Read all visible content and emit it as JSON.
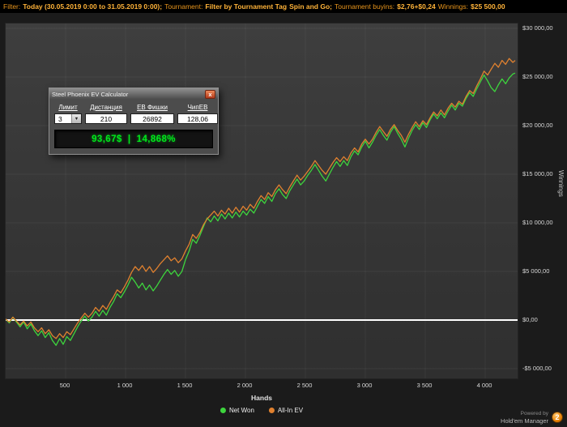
{
  "topbar": {
    "filter_label": "Filter:",
    "filter_value": "Today (30.05.2019 0:00 to 31.05.2019 0:00);",
    "tournament_label": "Tournament:",
    "tournament_value": "Filter by Tournament Tag",
    "tag_value": "Spin and Go;",
    "buyins_label": "Tournament buyins:",
    "buyins_value": "$2,76+$0,24",
    "winnings_label": "Winnings:",
    "winnings_value": "$25 500,00"
  },
  "ev_calculator": {
    "title": "Steel Phoenix EV Calculator",
    "close_glyph": "x",
    "columns": [
      "Лимит",
      "Дистанция",
      "ЕВ Фишки",
      "ЧипЕВ"
    ],
    "limit_value": "3",
    "dropdown_arrow": "▼",
    "distance_value": "210",
    "ev_chips_value": "26892",
    "chip_ev_value": "128,06",
    "result": "93,67$  |  14,868%"
  },
  "chart_data": {
    "type": "line",
    "title": "",
    "xlabel": "Hands",
    "ylabel": "Winnings",
    "xlim": [
      0,
      4270
    ],
    "ylim": [
      -6000,
      30500
    ],
    "grid": true,
    "legend_position": "bottom",
    "zero_line_color": "#ffffff",
    "x_ticks": [
      {
        "v": 500,
        "label": "500"
      },
      {
        "v": 1000,
        "label": "1 000"
      },
      {
        "v": 1500,
        "label": "1 500"
      },
      {
        "v": 2000,
        "label": "2 000"
      },
      {
        "v": 2500,
        "label": "2 500"
      },
      {
        "v": 3000,
        "label": "3 000"
      },
      {
        "v": 3500,
        "label": "3 500"
      },
      {
        "v": 4000,
        "label": "4 000"
      }
    ],
    "y_ticks": [
      {
        "v": 30000,
        "label": "$30 000,00"
      },
      {
        "v": 25000,
        "label": "$25 000,00"
      },
      {
        "v": 20000,
        "label": "$20 000,00"
      },
      {
        "v": 15000,
        "label": "$15 000,00"
      },
      {
        "v": 10000,
        "label": "$10 000,00"
      },
      {
        "v": 5000,
        "label": "$5 000,00"
      },
      {
        "v": 0,
        "label": "$0,00"
      },
      {
        "v": -5000,
        "label": "-$5 000,00"
      }
    ],
    "series": [
      {
        "name": "Net Won",
        "color": "#3dd43d",
        "points": [
          [
            0,
            100
          ],
          [
            30,
            -300
          ],
          [
            60,
            300
          ],
          [
            90,
            -200
          ],
          [
            120,
            -700
          ],
          [
            150,
            -200
          ],
          [
            180,
            -900
          ],
          [
            210,
            -400
          ],
          [
            240,
            -1100
          ],
          [
            270,
            -1600
          ],
          [
            300,
            -1100
          ],
          [
            330,
            -1800
          ],
          [
            360,
            -1300
          ],
          [
            390,
            -2100
          ],
          [
            420,
            -2600
          ],
          [
            450,
            -1900
          ],
          [
            480,
            -2500
          ],
          [
            510,
            -1700
          ],
          [
            540,
            -2100
          ],
          [
            570,
            -1400
          ],
          [
            600,
            -700
          ],
          [
            630,
            -100
          ],
          [
            660,
            400
          ],
          [
            690,
            -100
          ],
          [
            720,
            300
          ],
          [
            750,
            900
          ],
          [
            780,
            400
          ],
          [
            810,
            1000
          ],
          [
            840,
            500
          ],
          [
            870,
            1300
          ],
          [
            900,
            1900
          ],
          [
            930,
            2700
          ],
          [
            960,
            2300
          ],
          [
            990,
            2900
          ],
          [
            1020,
            3600
          ],
          [
            1050,
            4400
          ],
          [
            1080,
            3900
          ],
          [
            1110,
            3300
          ],
          [
            1140,
            3800
          ],
          [
            1170,
            3100
          ],
          [
            1200,
            3600
          ],
          [
            1230,
            3000
          ],
          [
            1260,
            3500
          ],
          [
            1290,
            4100
          ],
          [
            1320,
            4700
          ],
          [
            1350,
            5200
          ],
          [
            1380,
            4700
          ],
          [
            1410,
            5100
          ],
          [
            1440,
            4500
          ],
          [
            1470,
            5000
          ],
          [
            1500,
            6200
          ],
          [
            1530,
            7100
          ],
          [
            1560,
            8300
          ],
          [
            1590,
            7900
          ],
          [
            1620,
            8700
          ],
          [
            1650,
            9600
          ],
          [
            1680,
            10500
          ],
          [
            1710,
            10100
          ],
          [
            1740,
            10700
          ],
          [
            1770,
            10200
          ],
          [
            1800,
            10900
          ],
          [
            1830,
            10400
          ],
          [
            1860,
            11000
          ],
          [
            1890,
            10500
          ],
          [
            1920,
            11100
          ],
          [
            1950,
            10600
          ],
          [
            1980,
            11200
          ],
          [
            2010,
            10800
          ],
          [
            2040,
            11400
          ],
          [
            2070,
            11000
          ],
          [
            2100,
            11700
          ],
          [
            2130,
            12400
          ],
          [
            2160,
            12000
          ],
          [
            2190,
            12700
          ],
          [
            2220,
            12200
          ],
          [
            2250,
            13000
          ],
          [
            2280,
            13500
          ],
          [
            2310,
            12900
          ],
          [
            2340,
            12500
          ],
          [
            2370,
            13300
          ],
          [
            2400,
            13900
          ],
          [
            2430,
            14500
          ],
          [
            2460,
            13900
          ],
          [
            2490,
            14300
          ],
          [
            2520,
            14900
          ],
          [
            2550,
            15400
          ],
          [
            2580,
            16000
          ],
          [
            2610,
            15400
          ],
          [
            2640,
            14800
          ],
          [
            2670,
            14300
          ],
          [
            2700,
            15000
          ],
          [
            2730,
            15700
          ],
          [
            2760,
            16300
          ],
          [
            2790,
            15800
          ],
          [
            2820,
            16400
          ],
          [
            2850,
            15900
          ],
          [
            2880,
            16800
          ],
          [
            2910,
            17400
          ],
          [
            2940,
            17000
          ],
          [
            2970,
            17800
          ],
          [
            3000,
            18400
          ],
          [
            3030,
            17700
          ],
          [
            3060,
            18300
          ],
          [
            3090,
            19000
          ],
          [
            3120,
            19600
          ],
          [
            3150,
            19000
          ],
          [
            3180,
            18500
          ],
          [
            3210,
            19300
          ],
          [
            3240,
            19900
          ],
          [
            3270,
            19200
          ],
          [
            3300,
            18600
          ],
          [
            3330,
            17800
          ],
          [
            3360,
            18700
          ],
          [
            3390,
            19500
          ],
          [
            3420,
            20100
          ],
          [
            3450,
            19600
          ],
          [
            3480,
            20300
          ],
          [
            3510,
            19800
          ],
          [
            3540,
            20600
          ],
          [
            3570,
            21200
          ],
          [
            3600,
            20700
          ],
          [
            3630,
            21300
          ],
          [
            3660,
            20800
          ],
          [
            3690,
            21500
          ],
          [
            3720,
            22100
          ],
          [
            3750,
            21600
          ],
          [
            3780,
            22300
          ],
          [
            3810,
            22000
          ],
          [
            3840,
            22800
          ],
          [
            3870,
            23400
          ],
          [
            3900,
            23000
          ],
          [
            3930,
            23800
          ],
          [
            3960,
            24500
          ],
          [
            3990,
            25200
          ],
          [
            4020,
            24600
          ],
          [
            4050,
            23900
          ],
          [
            4080,
            23500
          ],
          [
            4110,
            24200
          ],
          [
            4140,
            24800
          ],
          [
            4170,
            24300
          ],
          [
            4200,
            24900
          ],
          [
            4230,
            25300
          ],
          [
            4250,
            25400
          ]
        ]
      },
      {
        "name": "All-In EV",
        "color": "#e0812f",
        "points": [
          [
            0,
            100
          ],
          [
            30,
            -200
          ],
          [
            60,
            300
          ],
          [
            90,
            -100
          ],
          [
            120,
            -500
          ],
          [
            150,
            -100
          ],
          [
            180,
            -600
          ],
          [
            210,
            -200
          ],
          [
            240,
            -800
          ],
          [
            270,
            -1200
          ],
          [
            300,
            -800
          ],
          [
            330,
            -1400
          ],
          [
            360,
            -1000
          ],
          [
            390,
            -1600
          ],
          [
            420,
            -1900
          ],
          [
            450,
            -1400
          ],
          [
            480,
            -1800
          ],
          [
            510,
            -1200
          ],
          [
            540,
            -1500
          ],
          [
            570,
            -900
          ],
          [
            600,
            -300
          ],
          [
            630,
            200
          ],
          [
            660,
            700
          ],
          [
            690,
            300
          ],
          [
            720,
            700
          ],
          [
            750,
            1300
          ],
          [
            780,
            900
          ],
          [
            810,
            1500
          ],
          [
            840,
            1100
          ],
          [
            870,
            1800
          ],
          [
            900,
            2400
          ],
          [
            930,
            3100
          ],
          [
            960,
            2800
          ],
          [
            990,
            3400
          ],
          [
            1020,
            4100
          ],
          [
            1050,
            4900
          ],
          [
            1080,
            5500
          ],
          [
            1110,
            5100
          ],
          [
            1140,
            5600
          ],
          [
            1170,
            5000
          ],
          [
            1200,
            5500
          ],
          [
            1230,
            4900
          ],
          [
            1260,
            5300
          ],
          [
            1290,
            5800
          ],
          [
            1320,
            6200
          ],
          [
            1350,
            6600
          ],
          [
            1380,
            6100
          ],
          [
            1410,
            6400
          ],
          [
            1440,
            5900
          ],
          [
            1470,
            6300
          ],
          [
            1500,
            7100
          ],
          [
            1530,
            7800
          ],
          [
            1560,
            8800
          ],
          [
            1590,
            8400
          ],
          [
            1620,
            9000
          ],
          [
            1650,
            9800
          ],
          [
            1680,
            10400
          ],
          [
            1710,
            10800
          ],
          [
            1740,
            11200
          ],
          [
            1770,
            10700
          ],
          [
            1800,
            11300
          ],
          [
            1830,
            10900
          ],
          [
            1860,
            11500
          ],
          [
            1890,
            11000
          ],
          [
            1920,
            11600
          ],
          [
            1950,
            11100
          ],
          [
            1980,
            11700
          ],
          [
            2010,
            11300
          ],
          [
            2040,
            11900
          ],
          [
            2070,
            11500
          ],
          [
            2100,
            12200
          ],
          [
            2130,
            12800
          ],
          [
            2160,
            12400
          ],
          [
            2190,
            13100
          ],
          [
            2220,
            12700
          ],
          [
            2250,
            13400
          ],
          [
            2280,
            13900
          ],
          [
            2310,
            13400
          ],
          [
            2340,
            13000
          ],
          [
            2370,
            13700
          ],
          [
            2400,
            14300
          ],
          [
            2430,
            14900
          ],
          [
            2460,
            14400
          ],
          [
            2490,
            14800
          ],
          [
            2520,
            15300
          ],
          [
            2550,
            15800
          ],
          [
            2580,
            16400
          ],
          [
            2610,
            15900
          ],
          [
            2640,
            15400
          ],
          [
            2670,
            15000
          ],
          [
            2700,
            15600
          ],
          [
            2730,
            16200
          ],
          [
            2760,
            16700
          ],
          [
            2790,
            16300
          ],
          [
            2820,
            16800
          ],
          [
            2850,
            16400
          ],
          [
            2880,
            17200
          ],
          [
            2910,
            17700
          ],
          [
            2940,
            17300
          ],
          [
            2970,
            18100
          ],
          [
            3000,
            18600
          ],
          [
            3030,
            18100
          ],
          [
            3060,
            18600
          ],
          [
            3090,
            19300
          ],
          [
            3120,
            19900
          ],
          [
            3150,
            19400
          ],
          [
            3180,
            18900
          ],
          [
            3210,
            19600
          ],
          [
            3240,
            20100
          ],
          [
            3270,
            19500
          ],
          [
            3300,
            19000
          ],
          [
            3330,
            18300
          ],
          [
            3360,
            19100
          ],
          [
            3390,
            19800
          ],
          [
            3420,
            20400
          ],
          [
            3450,
            19900
          ],
          [
            3480,
            20500
          ],
          [
            3510,
            20100
          ],
          [
            3540,
            20800
          ],
          [
            3570,
            21400
          ],
          [
            3600,
            21000
          ],
          [
            3630,
            21600
          ],
          [
            3660,
            21100
          ],
          [
            3690,
            21800
          ],
          [
            3720,
            22300
          ],
          [
            3750,
            21900
          ],
          [
            3780,
            22500
          ],
          [
            3810,
            22200
          ],
          [
            3840,
            23000
          ],
          [
            3870,
            23600
          ],
          [
            3900,
            23300
          ],
          [
            3930,
            24100
          ],
          [
            3960,
            24800
          ],
          [
            3990,
            25600
          ],
          [
            4020,
            25200
          ],
          [
            4050,
            25800
          ],
          [
            4080,
            26400
          ],
          [
            4110,
            26000
          ],
          [
            4140,
            26700
          ],
          [
            4170,
            26300
          ],
          [
            4200,
            26900
          ],
          [
            4230,
            26500
          ],
          [
            4250,
            26700
          ]
        ]
      }
    ]
  },
  "footer": {
    "powered_by": "Powered by",
    "brand": "Hold'em Manager",
    "badge": "2"
  }
}
